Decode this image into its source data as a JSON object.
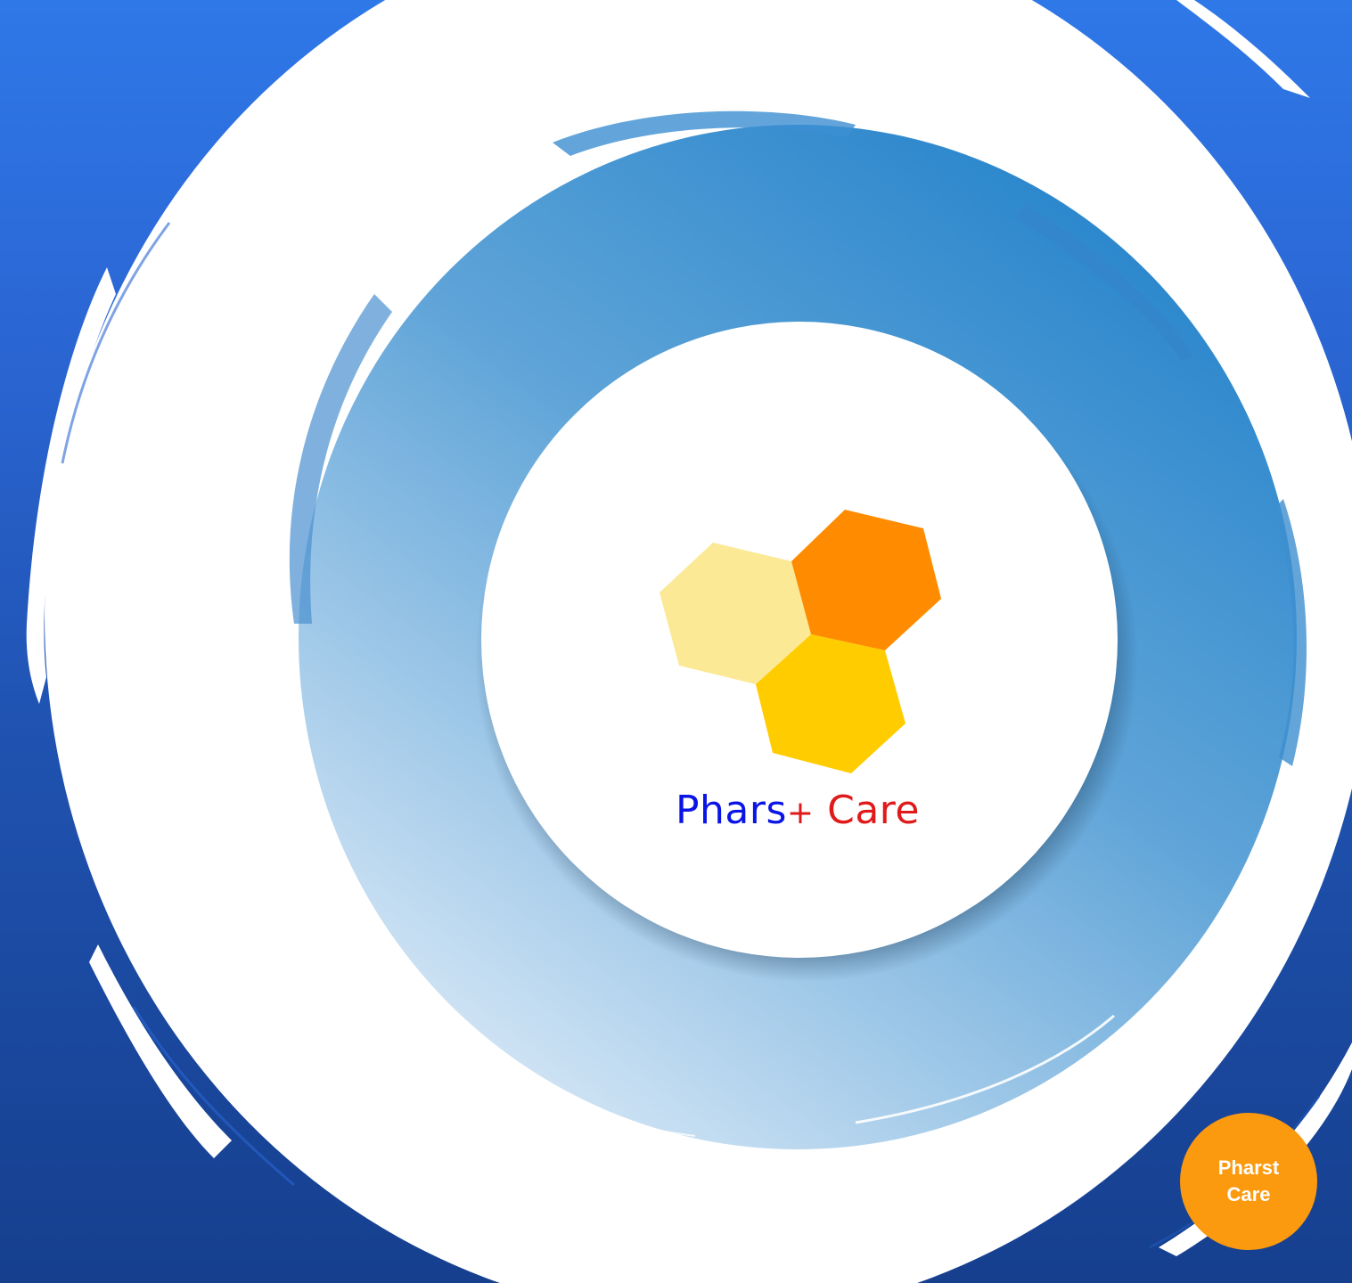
{
  "brand": {
    "name_part1": "Phars",
    "name_plus": "+",
    "name_part2": "Care"
  },
  "badge": {
    "line1": "Pharst",
    "line2": "Care"
  },
  "colors": {
    "background_blue": "#2a65d2",
    "ring_blue": "#3a8ed0",
    "hex_light_yellow": "#fbe995",
    "hex_orange": "#ff8c00",
    "hex_yellow": "#ffcc00",
    "brand_blue": "#0a14e6",
    "brand_red": "#e01a1a",
    "badge_orange": "#fb9a0f"
  }
}
